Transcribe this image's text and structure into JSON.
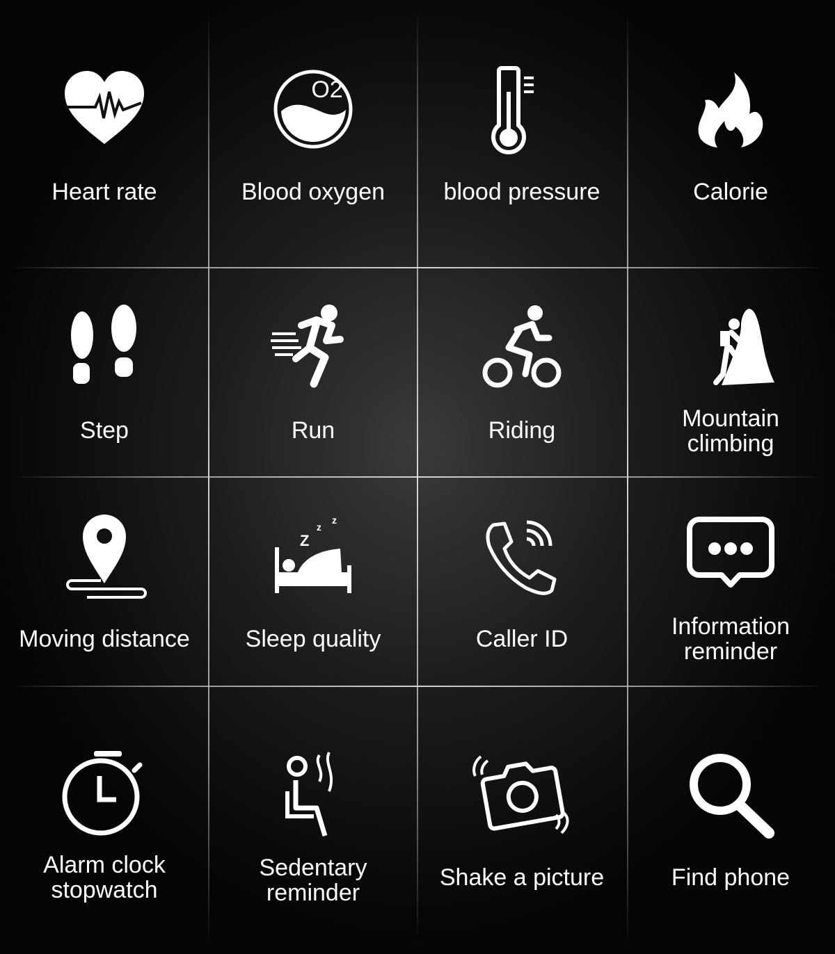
{
  "features": [
    {
      "label": "Heart rate",
      "icon": "heart-rate-icon"
    },
    {
      "label": "Blood oxygen",
      "icon": "blood-oxygen-icon",
      "icon_text": "O2"
    },
    {
      "label": "blood pressure",
      "icon": "thermometer-icon"
    },
    {
      "label": "Calorie",
      "icon": "flame-icon"
    },
    {
      "label": "Step",
      "icon": "footprints-icon"
    },
    {
      "label": "Run",
      "icon": "runner-icon"
    },
    {
      "label": "Riding",
      "icon": "cyclist-icon"
    },
    {
      "label": "Mountain climbing",
      "line1": "Mountain",
      "line2": "climbing",
      "icon": "climber-icon"
    },
    {
      "label": "Moving distance",
      "icon": "location-pin-icon"
    },
    {
      "label": "Sleep quality",
      "icon": "sleep-bed-icon"
    },
    {
      "label": "Caller ID",
      "icon": "phone-ringing-icon"
    },
    {
      "label": "Information reminder",
      "line1": "Information",
      "line2": "reminder",
      "icon": "message-bubble-icon"
    },
    {
      "label": "Alarm clock stopwatch",
      "line1": "Alarm clock",
      "line2": "stopwatch",
      "icon": "stopwatch-icon"
    },
    {
      "label": "Sedentary reminder",
      "line1": "Sedentary",
      "line2": "reminder",
      "icon": "sedentary-icon"
    },
    {
      "label": "Shake a picture",
      "icon": "shaking-camera-icon"
    },
    {
      "label": "Find phone",
      "icon": "magnifier-icon"
    }
  ],
  "colors": {
    "background": "#0a0a0a",
    "foreground": "#ffffff",
    "grid_line": "#c8c8c8"
  }
}
